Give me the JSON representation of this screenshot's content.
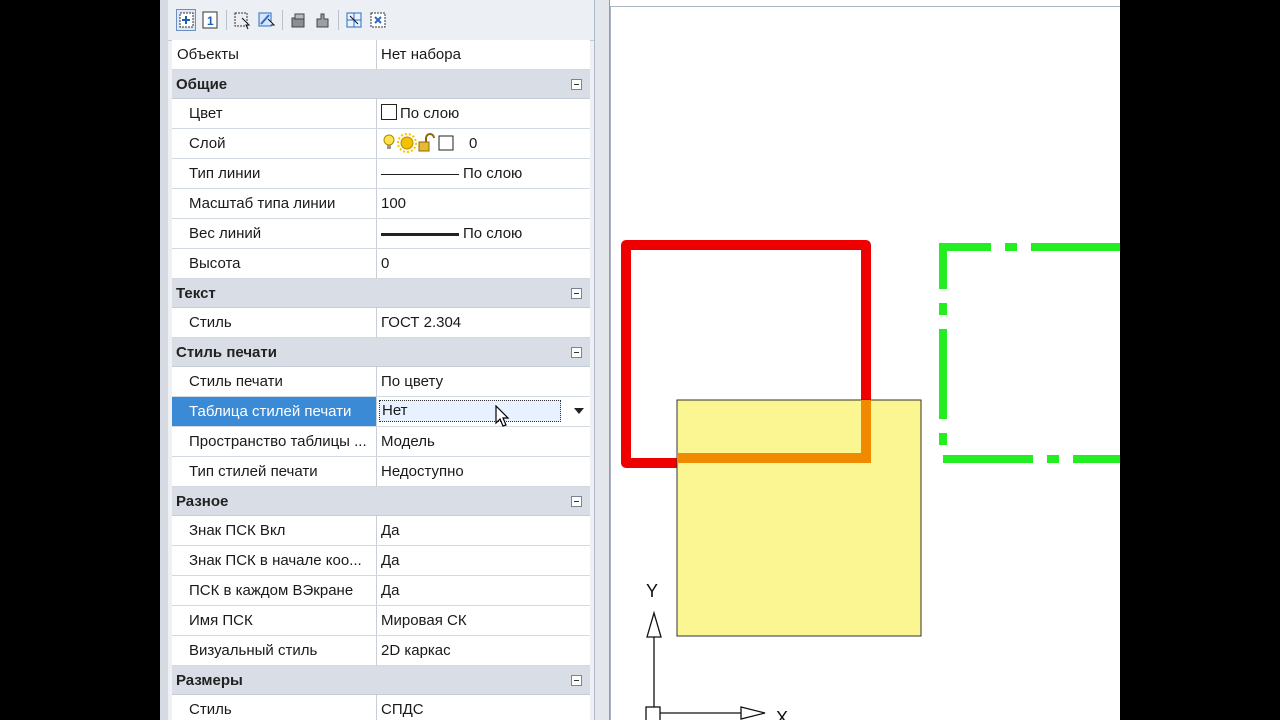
{
  "toolbar": {
    "buttons": [
      "quick-select-icon",
      "toggle-pickadd-icon",
      "select-objects-icon",
      "select-similar-icon",
      "match-properties-icon",
      "paste-properties-icon",
      "grid-icon",
      "hide-icon"
    ]
  },
  "properties": {
    "objects_label": "Объекты",
    "objects_value": "Нет набора",
    "general": {
      "title": "Общие",
      "color_label": "Цвет",
      "color_value": "По слою",
      "layer_label": "Слой",
      "layer_value": "0",
      "linetype_label": "Тип линии",
      "linetype_value": "По слою",
      "ltscale_label": "Масштаб типа линии",
      "ltscale_value": "100",
      "lineweight_label": "Вес линий",
      "lineweight_value": "По слою",
      "height_label": "Высота",
      "height_value": "0"
    },
    "text": {
      "title": "Текст",
      "style_label": "Стиль",
      "style_value": "ГОСТ 2.304"
    },
    "plot": {
      "title": "Стиль печати",
      "style_label": "Стиль печати",
      "style_value": "По цвету",
      "table_label": "Таблица стилей печати",
      "table_value": "Нет",
      "space_label": "Пространство таблицы ...",
      "space_value": "Модель",
      "type_label": "Тип стилей печати",
      "type_value": "Недоступно"
    },
    "misc": {
      "title": "Разное",
      "ucs_on_label": "Знак ПСК Вкл",
      "ucs_on_value": "Да",
      "ucs_origin_label": "Знак ПСК в начале коо...",
      "ucs_origin_value": "Да",
      "ucs_vp_label": "ПСК в каждом ВЭкране",
      "ucs_vp_value": "Да",
      "ucs_name_label": "Имя ПСК",
      "ucs_name_value": "Мировая СК",
      "visual_label": "Визуальный стиль",
      "visual_value": "2D каркас"
    },
    "dims": {
      "title": "Размеры",
      "style_label": "Стиль",
      "style_value": "СПДС"
    }
  },
  "canvas": {
    "axis_y_label": "Y",
    "axis_x_label": "X",
    "colors": {
      "red": "#ee0000",
      "green": "#22ee22",
      "yellow": "#fbf691",
      "overlap": "#f08a00"
    }
  }
}
